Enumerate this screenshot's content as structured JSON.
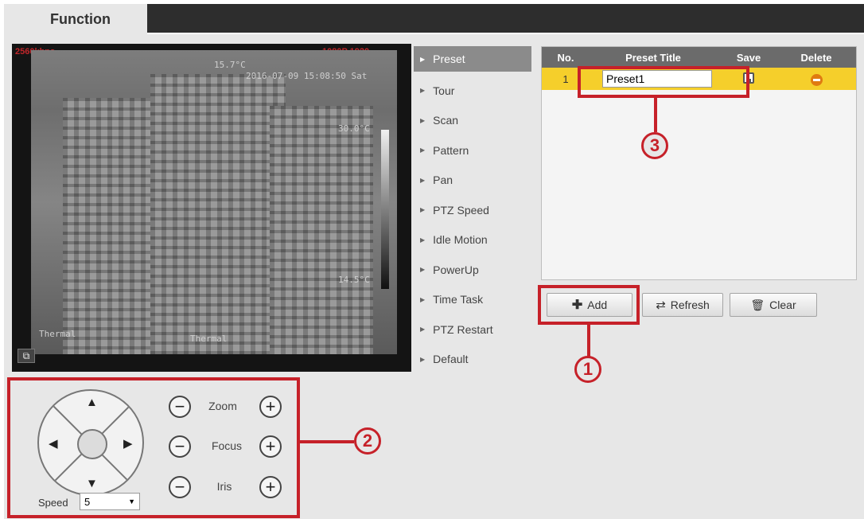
{
  "tab": {
    "label": "Function"
  },
  "video": {
    "osd_top_left": "2560kbps",
    "osd_top_right": "1080P 1920",
    "osd_timestamp": "2016-07-09 15:08:50 Sat",
    "osd_small_top": "15.7°C",
    "osd_scale_top": "30.0°C",
    "osd_scale_bottom": "14.5°C",
    "osd_bottom_left": "Thermal",
    "osd_bottom_center": "Thermal"
  },
  "menu": {
    "items": [
      {
        "label": "Preset",
        "active": true
      },
      {
        "label": "Tour",
        "active": false
      },
      {
        "label": "Scan",
        "active": false
      },
      {
        "label": "Pattern",
        "active": false
      },
      {
        "label": "Pan",
        "active": false
      },
      {
        "label": "PTZ Speed",
        "active": false
      },
      {
        "label": "Idle Motion",
        "active": false
      },
      {
        "label": "PowerUp",
        "active": false
      },
      {
        "label": "Time Task",
        "active": false
      },
      {
        "label": "PTZ Restart",
        "active": false
      },
      {
        "label": "Default",
        "active": false
      }
    ]
  },
  "preset_table": {
    "columns": [
      "No.",
      "Preset Title",
      "Save",
      "Delete"
    ],
    "rows": [
      {
        "no": "1",
        "title": "Preset1"
      }
    ]
  },
  "buttons": {
    "add": "Add",
    "refresh": "Refresh",
    "clear": "Clear"
  },
  "ptz": {
    "zoom_label": "Zoom",
    "focus_label": "Focus",
    "iris_label": "Iris",
    "speed_label": "Speed",
    "speed_value": "5"
  },
  "callouts": {
    "one": "1",
    "two": "2",
    "three": "3"
  },
  "colors": {
    "highlight": "#c62129",
    "selected_row": "#f5cf2b",
    "active_menu": "#8b8b8b"
  }
}
